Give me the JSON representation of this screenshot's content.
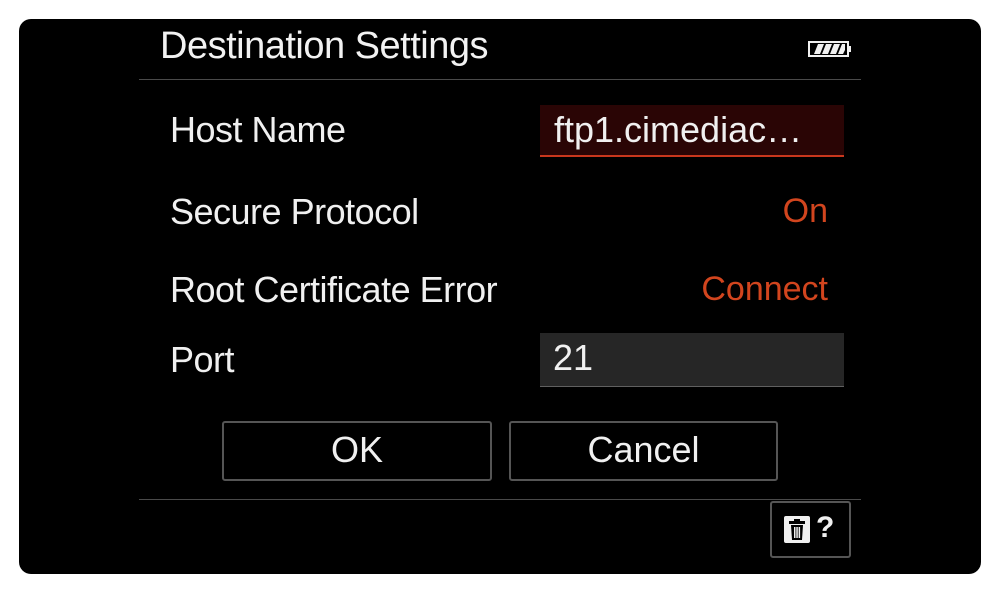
{
  "header": {
    "title": "Destination Settings",
    "battery_icon": "battery-full-icon"
  },
  "settings": {
    "host_name": {
      "label": "Host Name",
      "value": "ftp1.cimediac…"
    },
    "secure_protocol": {
      "label": "Secure Protocol",
      "value": "On"
    },
    "root_certificate_error": {
      "label": "Root Certificate Error",
      "value": "Connect"
    },
    "port": {
      "label": "Port",
      "value": "21"
    }
  },
  "buttons": {
    "ok_label": "OK",
    "cancel_label": "Cancel"
  },
  "footer": {
    "delete_icon": "trash-icon",
    "help_label": "?"
  },
  "colors": {
    "background": "#000000",
    "accent": "#d2451e",
    "selected_field_bg": "#2a0505",
    "field_bg": "#262626",
    "text": "#f0f0f0"
  }
}
